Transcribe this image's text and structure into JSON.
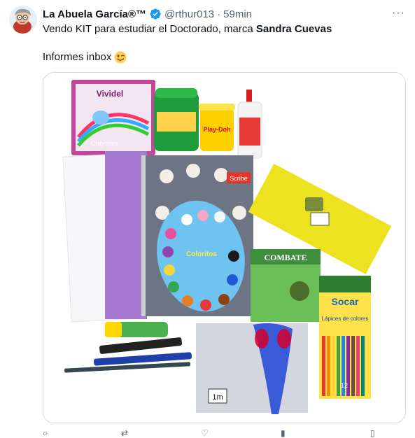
{
  "tweet": {
    "display_name": "La Abuela García®™",
    "handle": "@rthur013",
    "separator": "·",
    "time": "59min",
    "more_label": "···",
    "text_prefix": "Vendo KIT para estudiar el Doctorado, marca ",
    "text_bold": "Sandra Cuevas",
    "line2": "Informes inbox"
  },
  "media": {
    "labels": {
      "vividel": "Vividel",
      "crayones": "Crayones",
      "scribe": "Scribe",
      "coloritos": "Coloritos",
      "combate": "COMBATE",
      "socar": "Socar",
      "lapices": "Lápices de colores",
      "twelve": "12",
      "one_m": "1m",
      "playdoh": "Play-Doh"
    }
  },
  "icons": [
    "verified-badge-icon",
    "wink-emoji-icon",
    "more-options-icon"
  ],
  "colors": {
    "verified": "#1d9bf0",
    "muted": "#536471",
    "text": "#0f1419",
    "border": "#cfd9de"
  }
}
